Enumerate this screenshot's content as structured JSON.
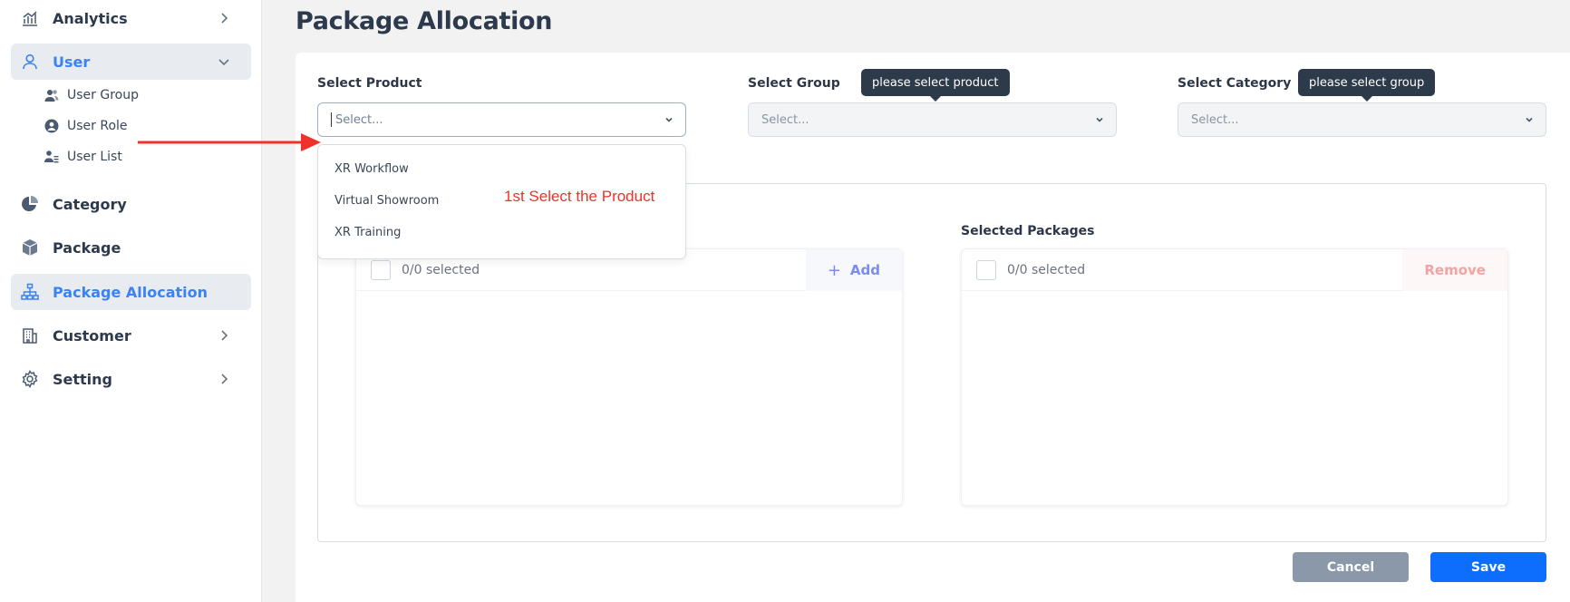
{
  "sidebar": {
    "analytics": "Analytics",
    "user": "User",
    "user_children": [
      "User Group",
      "User Role",
      "User List"
    ],
    "category": "Category",
    "package": "Package",
    "package_allocation": "Package Allocation",
    "customer": "Customer",
    "setting": "Setting"
  },
  "page": {
    "title": "Package Allocation"
  },
  "form": {
    "product": {
      "label": "Select Product",
      "placeholder": "Select..."
    },
    "group": {
      "label": "Select Group",
      "placeholder": "Select...",
      "tooltip": "please select product"
    },
    "category": {
      "label": "Select Category",
      "placeholder": "Select...",
      "tooltip": "please select group"
    }
  },
  "dropdown": {
    "options": [
      "XR Workflow",
      "Virtual Showroom",
      "XR Training"
    ]
  },
  "annotation": {
    "text": "1st Select the Product",
    "color": "#f0302a"
  },
  "transfer": {
    "left": {
      "count": "0/0 selected",
      "action": "Add"
    },
    "right": {
      "title": "Selected Packages",
      "count": "0/0 selected",
      "action": "Remove"
    }
  },
  "actions": {
    "cancel": "Cancel",
    "save": "Save"
  },
  "colors": {
    "accent": "#3b82f6",
    "primary_button": "#0d6efd",
    "secondary_button": "#8a98aa",
    "tooltip_bg": "#2d3a4a"
  }
}
